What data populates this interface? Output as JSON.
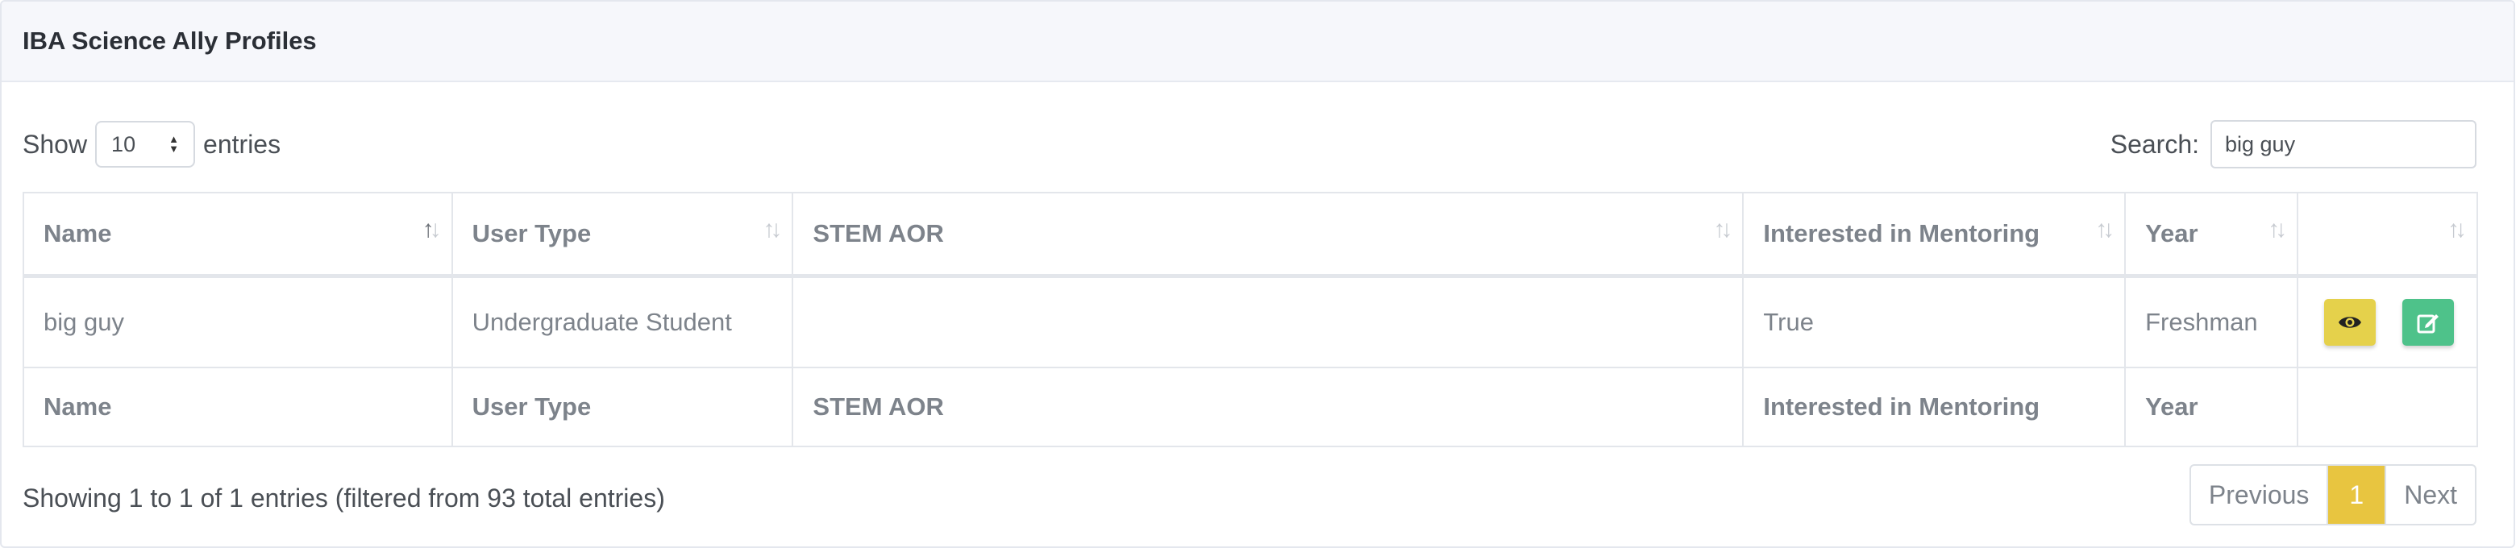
{
  "card": {
    "title": "IBA Science Ally Profiles"
  },
  "length": {
    "show_label": "Show",
    "value": "10",
    "entries_label": "entries"
  },
  "search": {
    "label": "Search:",
    "value": "big guy"
  },
  "table": {
    "columns": [
      "Name",
      "User Type",
      "STEM AOR",
      "Interested in Mentoring",
      "Year",
      ""
    ],
    "sort_active_column": "Name",
    "rows": [
      {
        "name": "big guy",
        "user_type": "Undergraduate Student",
        "stem_aor": "",
        "interested_in_mentoring": "True",
        "year": "Freshman"
      }
    ],
    "footer": [
      "Name",
      "User Type",
      "STEM AOR",
      "Interested in Mentoring",
      "Year",
      ""
    ]
  },
  "actions": {
    "view_icon": "eye-icon",
    "edit_icon": "edit-icon"
  },
  "info": "Showing 1 to 1 of 1 entries (filtered from 93 total entries)",
  "pagination": {
    "previous": "Previous",
    "current": "1",
    "next": "Next"
  },
  "colors": {
    "view_button": "#e5d14b",
    "edit_button": "#4ec28a",
    "active_page": "#e8c540"
  }
}
